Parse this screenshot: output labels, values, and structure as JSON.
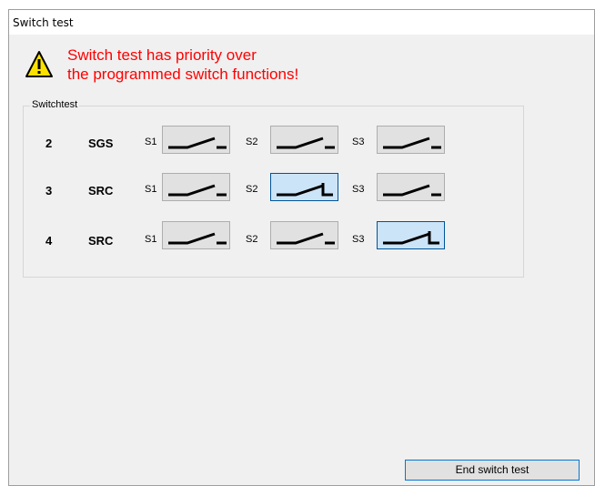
{
  "window": {
    "title": "Switch test"
  },
  "warning": {
    "icon": "warning-triangle-icon",
    "line1": "Switch test has priority over",
    "line2": "the programmed switch functions!",
    "color": "#ff0000"
  },
  "group": {
    "label": "Switchtest",
    "rows": [
      {
        "number": "2",
        "type": "SGS",
        "switches": [
          {
            "label": "S1",
            "state": "open"
          },
          {
            "label": "S2",
            "state": "open"
          },
          {
            "label": "S3",
            "state": "open"
          }
        ]
      },
      {
        "number": "3",
        "type": "SRC",
        "switches": [
          {
            "label": "S1",
            "state": "open"
          },
          {
            "label": "S2",
            "state": "closed"
          },
          {
            "label": "S3",
            "state": "open"
          }
        ]
      },
      {
        "number": "4",
        "type": "SRC",
        "switches": [
          {
            "label": "S1",
            "state": "open"
          },
          {
            "label": "S2",
            "state": "open"
          },
          {
            "label": "S3",
            "state": "closed"
          }
        ]
      }
    ]
  },
  "footer": {
    "end_button": "End switch test"
  },
  "colors": {
    "active_button": "#cce4f7",
    "active_border": "#005499",
    "button": "#e1e1e1"
  }
}
